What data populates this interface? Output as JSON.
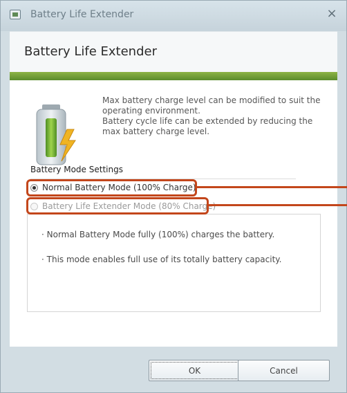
{
  "window": {
    "title": "Battery Life Extender",
    "close_glyph": "×"
  },
  "header": {
    "title": "Battery Life Extender"
  },
  "description": {
    "line1": "Max battery charge level can be modified to suit the operating environment.",
    "line2": "Battery cycle life can be extended by reducing the max battery charge level."
  },
  "settings": {
    "section_title": "Battery Mode Settings",
    "options": [
      {
        "label": "Normal Battery Mode (100% Charge)",
        "selected": true,
        "enabled": true
      },
      {
        "label": "Battery Life Extender Mode (80% Charge)",
        "selected": false,
        "enabled": false
      }
    ]
  },
  "info": {
    "bullets": [
      "· Normal Battery Mode fully (100%) charges the battery.",
      "· This mode enables full use of its totally battery capacity."
    ]
  },
  "buttons": {
    "ok": "OK",
    "cancel": "Cancel"
  },
  "colors": {
    "accent_green": "#6a9a33",
    "callout": "#c3461b",
    "titlebar": "#ccd8df"
  },
  "icons": {
    "app": "battery-app-icon",
    "battery": "battery-lightning-icon"
  }
}
